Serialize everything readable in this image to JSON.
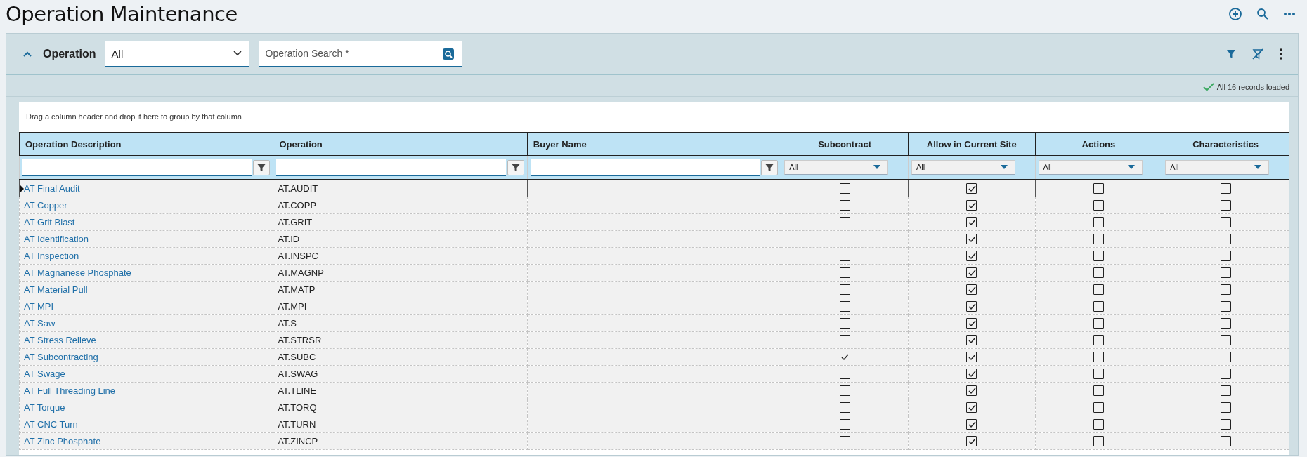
{
  "page": {
    "title": "Operation Maintenance"
  },
  "panel": {
    "title": "Operation",
    "expanded": true,
    "scope": {
      "value": "All"
    },
    "search": {
      "placeholder": "Operation Search *"
    }
  },
  "status": {
    "text": "All 16 records loaded"
  },
  "grid": {
    "group_hint": "Drag a column header and drop it here to group by that column",
    "columns": [
      {
        "label": "Operation Description",
        "kind": "text"
      },
      {
        "label": "Operation",
        "kind": "text"
      },
      {
        "label": "Buyer Name",
        "kind": "text"
      },
      {
        "label": "Subcontract",
        "kind": "check",
        "filter": "All"
      },
      {
        "label": "Allow in Current Site",
        "kind": "check",
        "filter": "All"
      },
      {
        "label": "Actions",
        "kind": "check",
        "filter": "All"
      },
      {
        "label": "Characteristics",
        "kind": "check",
        "filter": "All"
      }
    ],
    "rows": [
      {
        "selected": true,
        "description": "AT Final Audit",
        "operation": "AT.AUDIT",
        "checks": [
          false,
          true,
          false,
          false
        ]
      },
      {
        "selected": false,
        "description": "AT Copper",
        "operation": "AT.COPP",
        "checks": [
          false,
          true,
          false,
          false
        ]
      },
      {
        "selected": false,
        "description": "AT Grit Blast",
        "operation": "AT.GRIT",
        "checks": [
          false,
          true,
          false,
          false
        ]
      },
      {
        "selected": false,
        "description": "AT Identification",
        "operation": "AT.ID",
        "checks": [
          false,
          true,
          false,
          false
        ]
      },
      {
        "selected": false,
        "description": "AT Inspection",
        "operation": "AT.INSPC",
        "checks": [
          false,
          true,
          false,
          false
        ]
      },
      {
        "selected": false,
        "description": "AT Magnanese Phosphate",
        "operation": "AT.MAGNP",
        "checks": [
          false,
          true,
          false,
          false
        ]
      },
      {
        "selected": false,
        "description": "AT Material Pull",
        "operation": "AT.MATP",
        "checks": [
          false,
          true,
          false,
          false
        ]
      },
      {
        "selected": false,
        "description": "AT MPI",
        "operation": "AT.MPI",
        "checks": [
          false,
          true,
          false,
          false
        ]
      },
      {
        "selected": false,
        "description": "AT Saw",
        "operation": "AT.S",
        "checks": [
          false,
          true,
          false,
          false
        ]
      },
      {
        "selected": false,
        "description": "AT Stress Relieve",
        "operation": "AT.STRSR",
        "checks": [
          false,
          true,
          false,
          false
        ]
      },
      {
        "selected": false,
        "description": "AT Subcontracting",
        "operation": "AT.SUBC",
        "checks": [
          true,
          true,
          false,
          false
        ]
      },
      {
        "selected": false,
        "description": "AT Swage",
        "operation": "AT.SWAG",
        "checks": [
          false,
          true,
          false,
          false
        ]
      },
      {
        "selected": false,
        "description": "AT Full Threading Line",
        "operation": "AT.TLINE",
        "checks": [
          false,
          true,
          false,
          false
        ]
      },
      {
        "selected": false,
        "description": "AT Torque",
        "operation": "AT.TORQ",
        "checks": [
          false,
          true,
          false,
          false
        ]
      },
      {
        "selected": false,
        "description": "AT CNC Turn",
        "operation": "AT.TURN",
        "checks": [
          false,
          true,
          false,
          false
        ]
      },
      {
        "selected": false,
        "description": "AT Zinc Phosphate",
        "operation": "AT.ZINCP",
        "checks": [
          false,
          true,
          false,
          false
        ]
      }
    ]
  }
}
